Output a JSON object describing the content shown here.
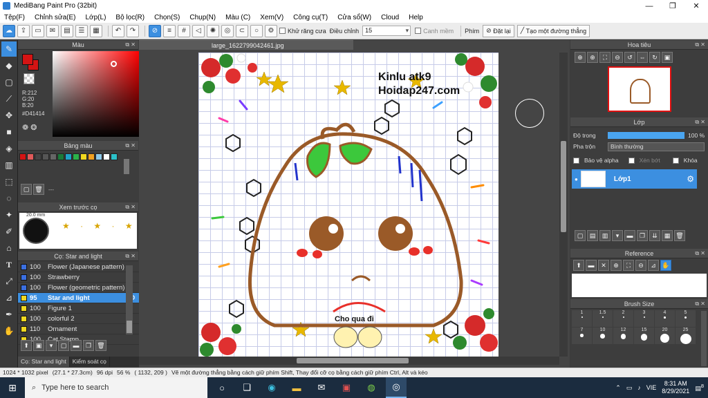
{
  "window": {
    "title": "MediBang Paint Pro (32bit)",
    "minimize": "—",
    "maximize": "❐",
    "close": "✕"
  },
  "menu": [
    "Tệp(F)",
    "Chỉnh sửa(E)",
    "Lớp(L)",
    "Bộ lọc(R)",
    "Chọn(S)",
    "Chụp(N)",
    "Màu (C)",
    "Xem(V)",
    "Công cụ(T)",
    "Cửa sổ(W)",
    "Cloud",
    "Help"
  ],
  "toolbar": {
    "antialias_label": "Khử răng cưa",
    "adjust_label": "Điều chỉnh",
    "adjust_value": "15",
    "smooth_label": "Canh mềm",
    "key_label": "Phím",
    "reset_label": "Đặt lại",
    "straight_line_label": "Tạo một đường thẳng"
  },
  "color_panel": {
    "title": "Màu",
    "r": "R:212",
    "g": "G:20",
    "b": "B:20",
    "hex": "#D41414",
    "fg_color": "#D41414"
  },
  "palette_panel": {
    "title": "Bảng màu",
    "colors": [
      "#d41414",
      "#e05a5a",
      "#444444",
      "#555555",
      "#666666",
      "#1b7a3a",
      "#1fa3c9",
      "#2cb24a",
      "#f0d820",
      "#f0a020",
      "#8cc8e8",
      "#ffffff",
      "#2cc1c9"
    ],
    "count_text": "---"
  },
  "preview_panel": {
    "title": "Xem trước cọ",
    "size_text": "20.0 mm"
  },
  "brush_panel": {
    "title": "Cọ: Star and light",
    "items": [
      {
        "size": "100",
        "name": "Flower (Japanese pattern)",
        "color": "#3b6fe0"
      },
      {
        "size": "100",
        "name": "Strawberry",
        "color": "#3b6fe0"
      },
      {
        "size": "100",
        "name": "Flower (geometric pattern)",
        "color": "#3b6fe0"
      },
      {
        "size": "95",
        "name": "Star and light",
        "color": "#f0d820"
      },
      {
        "size": "100",
        "name": "Figure 1",
        "color": "#f0d820"
      },
      {
        "size": "100",
        "name": "colorful 2",
        "color": "#f0d820"
      },
      {
        "size": "110",
        "name": "Ornament",
        "color": "#f0d820"
      },
      {
        "size": "100",
        "name": "Cat Stamp",
        "color": "#f0d820"
      }
    ]
  },
  "bottom_tabs": [
    "Cọ: Star and light",
    "Kiểm soát cọ"
  ],
  "canvas": {
    "tab_title": "large_1622799042461.jpg",
    "watermark_line1": "Kinlu atk9",
    "watermark_line2": "Hoidap247.com",
    "caption": "Cho qua đi"
  },
  "navigator_panel": {
    "title": "Hoa tiêu"
  },
  "layer_panel": {
    "title": "Lớp",
    "opacity_label": "Độ trong",
    "opacity_value": "100 %",
    "opacity_fraction": 1.0,
    "blend_label": "Pha trộn",
    "blend_value": "Bình thường",
    "protect_alpha": "Bảo vệ alpha",
    "clipping": "Xén bớt",
    "lock": "Khóa",
    "layer_name": "Lớp1"
  },
  "reference_panel": {
    "title": "Reference"
  },
  "brushsize_panel": {
    "title": "Brush Size",
    "sizes": [
      "1",
      "1.5",
      "2",
      "3",
      "4",
      "5",
      "7",
      "10",
      "12",
      "15",
      "20",
      "25"
    ]
  },
  "status": {
    "dimensions": "1024 * 1032 pixel",
    "physical": "(27.1 * 27.3cm)",
    "dpi": "96 dpi",
    "zoom": "56 %",
    "coords": "( 1132, 209 )",
    "hint": "Vẽ một đường thẳng bằng cách giữ phím Shift, Thay đổi cỡ cọ bằng cách giữ phím Ctrl, Alt và kéo"
  },
  "taskbar": {
    "search_placeholder": "Type here to search",
    "lang": "VIE",
    "time": "8:31 AM",
    "date": "8/29/2021",
    "notif_count": "8"
  }
}
